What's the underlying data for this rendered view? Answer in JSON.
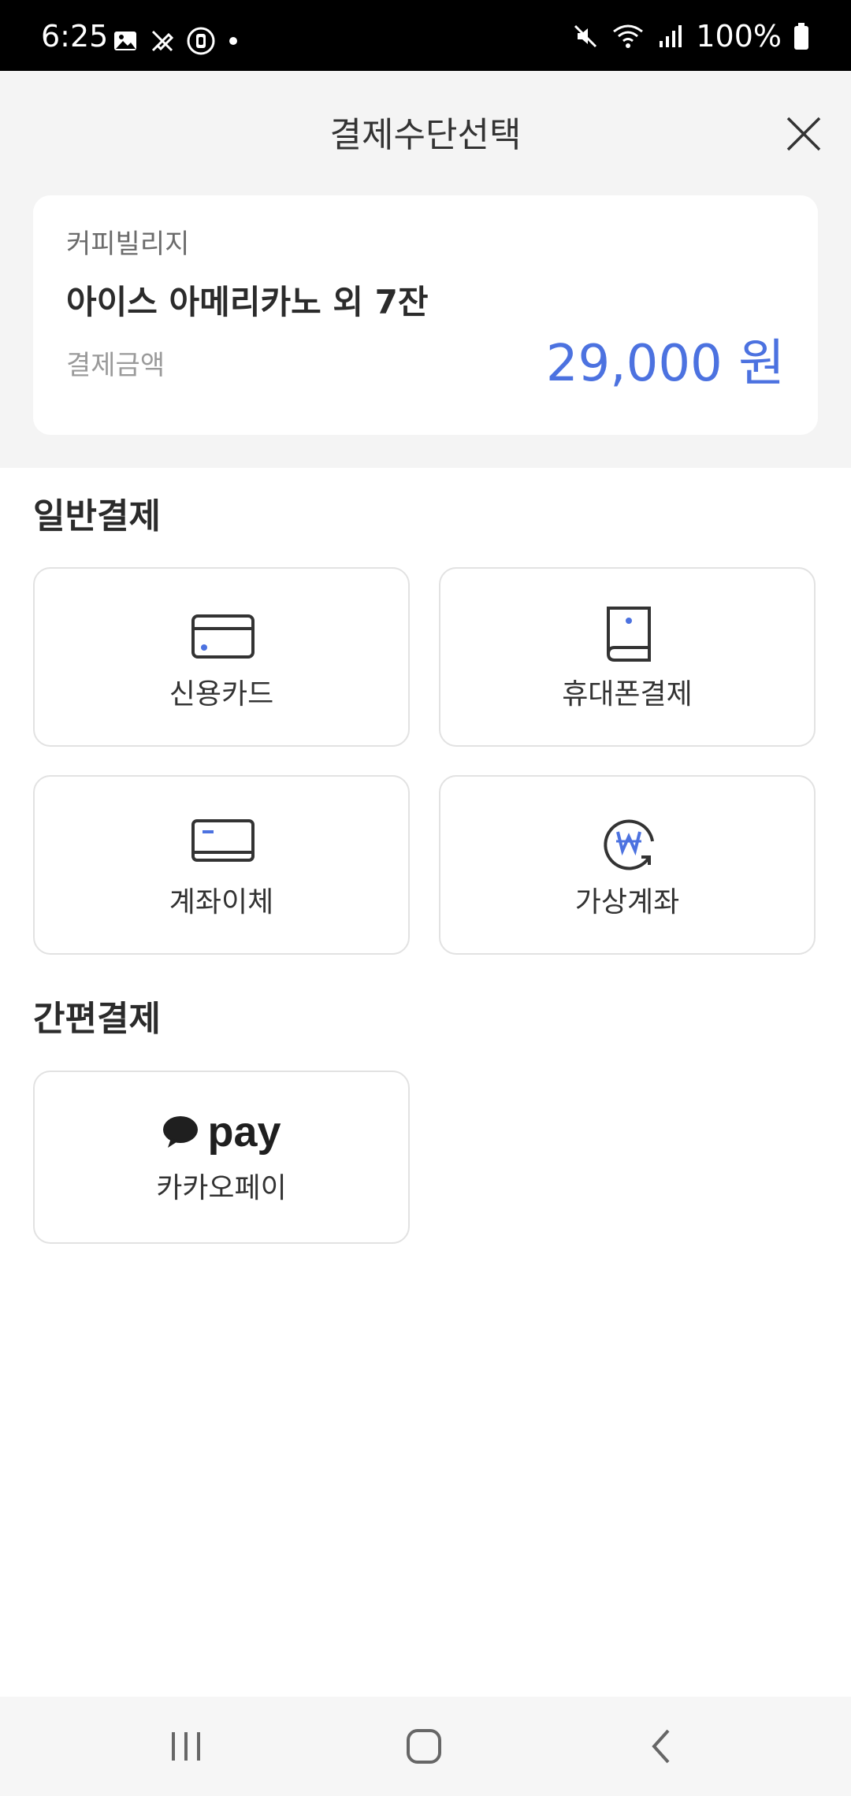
{
  "status_bar": {
    "time": "6:25",
    "battery": "100%",
    "icons": [
      "image-icon",
      "pen-off-icon",
      "lens-icon",
      "dot-icon",
      "mute-icon",
      "wifi-icon",
      "signal-icon",
      "battery-icon"
    ]
  },
  "header": {
    "title": "결제수단선택",
    "close_icon": "close-icon"
  },
  "order": {
    "store": "커피빌리지",
    "item": "아이스 아메리카노 외 7잔",
    "amount_label": "결제금액",
    "amount": "29,000 원"
  },
  "general": {
    "title": "일반결제",
    "methods": [
      {
        "label": "신용카드",
        "icon": "credit-card-icon"
      },
      {
        "label": "휴대폰결제",
        "icon": "phone-icon"
      },
      {
        "label": "계좌이체",
        "icon": "bank-transfer-icon"
      },
      {
        "label": "가상계좌",
        "icon": "virtual-account-icon"
      }
    ]
  },
  "easy": {
    "title": "간편결제",
    "methods": [
      {
        "label": "카카오페이",
        "logo_text": "pay",
        "icon": "speech-bubble-icon"
      }
    ]
  },
  "colors": {
    "accent": "#4c72e0",
    "background": "#f4f4f4",
    "tile_border": "#e2e2e2"
  },
  "nav": {
    "icons": [
      "recent-apps-icon",
      "home-icon",
      "back-icon"
    ]
  }
}
